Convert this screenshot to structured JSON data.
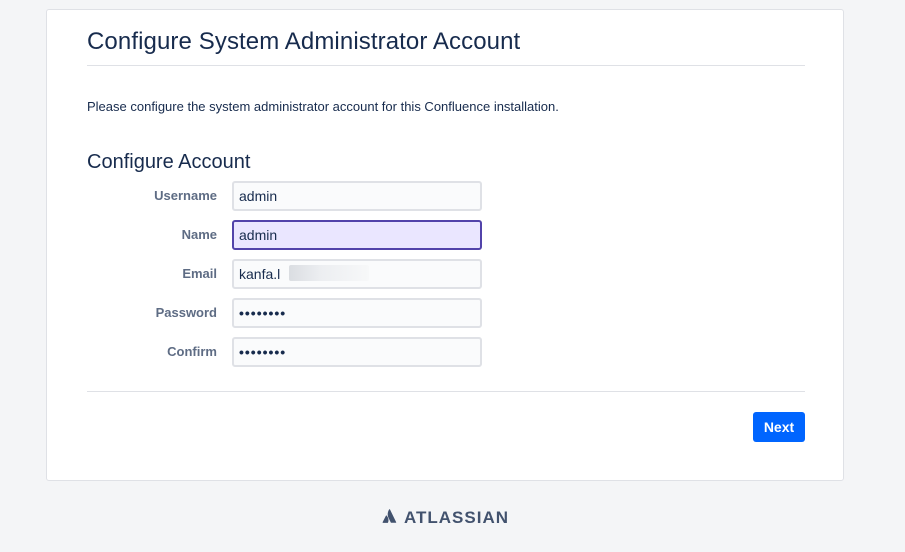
{
  "header": {
    "title": "Configure System Administrator Account"
  },
  "intro": {
    "text": "Please configure the system administrator account for this Confluence installation."
  },
  "form": {
    "section_title": "Configure Account",
    "fields": [
      {
        "label": "Username",
        "value": "admin"
      },
      {
        "label": "Name",
        "value": "admin"
      },
      {
        "label": "Email",
        "value": "kanfa.l"
      },
      {
        "label": "Password",
        "value": "••••••••"
      },
      {
        "label": "Confirm",
        "value": "••••••••"
      }
    ]
  },
  "actions": {
    "next_label": "Next"
  },
  "footer": {
    "brand": "ATLASSIAN",
    "logo_icon": "atlassian-logo-icon"
  },
  "colors": {
    "primary": "#0065ff",
    "focus_border": "#5243aa",
    "focus_bg": "#eae6ff",
    "text": "#172b4d",
    "label": "#5e6c84"
  }
}
